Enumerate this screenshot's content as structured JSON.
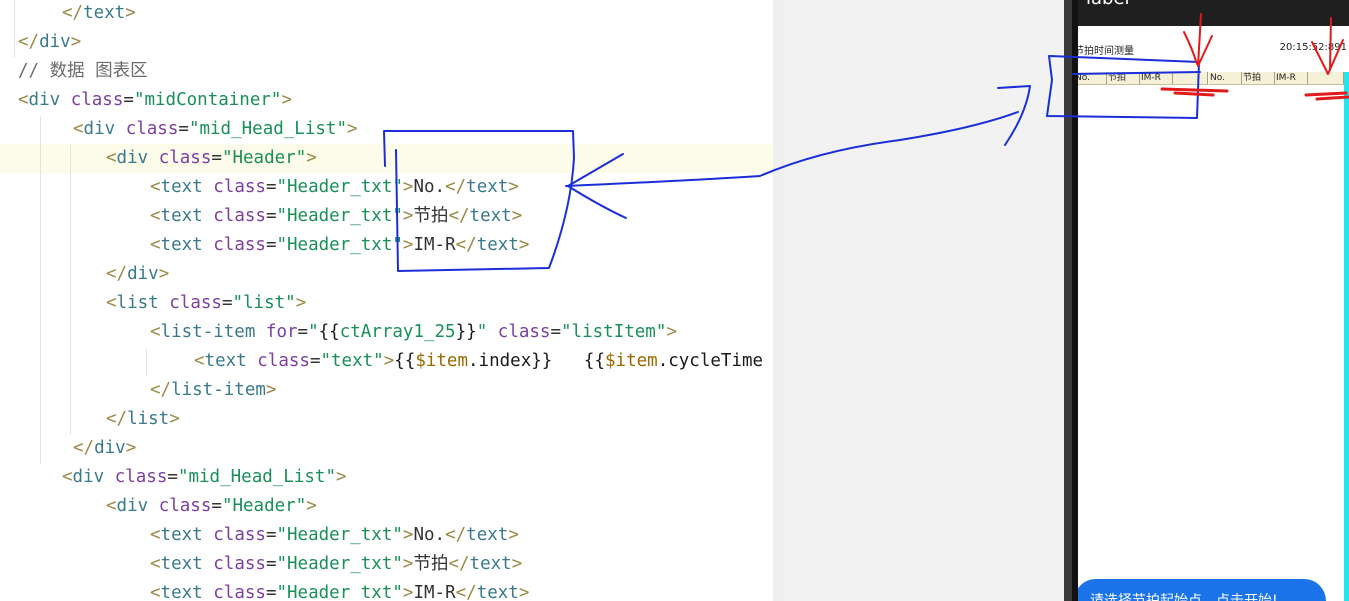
{
  "editor": {
    "lines": [
      {
        "indent": 62,
        "current": false,
        "tokens": [
          [
            "tb",
            "</"
          ],
          [
            "tag",
            "text"
          ],
          [
            "tb",
            ">"
          ]
        ]
      },
      {
        "indent": 18,
        "current": false,
        "tokens": [
          [
            "tb",
            "</"
          ],
          [
            "tag",
            "div"
          ],
          [
            "tb",
            ">"
          ]
        ]
      },
      {
        "indent": 18,
        "current": false,
        "tokens": [
          [
            "cmt",
            "// 数据 图表区"
          ]
        ]
      },
      {
        "indent": 18,
        "current": false,
        "tokens": [
          [
            "tb",
            "<"
          ],
          [
            "tag",
            "div"
          ],
          [
            "txt",
            " "
          ],
          [
            "attr",
            "class"
          ],
          [
            "eq",
            "="
          ],
          [
            "str",
            "\"midContainer\""
          ],
          [
            "tb",
            ">"
          ]
        ]
      },
      {
        "indent": 73,
        "current": false,
        "tokens": [
          [
            "tb",
            "<"
          ],
          [
            "tag",
            "div"
          ],
          [
            "txt",
            " "
          ],
          [
            "attr",
            "class"
          ],
          [
            "eq",
            "="
          ],
          [
            "str",
            "\"mid_Head_List\""
          ],
          [
            "tb",
            ">"
          ]
        ]
      },
      {
        "indent": 106,
        "current": true,
        "tokens": [
          [
            "tb",
            "<"
          ],
          [
            "tag",
            "div"
          ],
          [
            "txt",
            " "
          ],
          [
            "attr",
            "class"
          ],
          [
            "eq",
            "="
          ],
          [
            "str",
            "\"Header\""
          ],
          [
            "tb",
            ">"
          ]
        ]
      },
      {
        "indent": 150,
        "current": false,
        "tokens": [
          [
            "tb",
            "<"
          ],
          [
            "tag",
            "text"
          ],
          [
            "txt",
            " "
          ],
          [
            "attr",
            "class"
          ],
          [
            "eq",
            "="
          ],
          [
            "str",
            "\"Header_txt\""
          ],
          [
            "tb",
            ">"
          ],
          [
            "txt",
            "No."
          ],
          [
            "tb",
            "</"
          ],
          [
            "tag",
            "text"
          ],
          [
            "tb",
            ">"
          ]
        ]
      },
      {
        "indent": 150,
        "current": false,
        "tokens": [
          [
            "tb",
            "<"
          ],
          [
            "tag",
            "text"
          ],
          [
            "txt",
            " "
          ],
          [
            "attr",
            "class"
          ],
          [
            "eq",
            "="
          ],
          [
            "str",
            "\"Header_txt\""
          ],
          [
            "tb",
            ">"
          ],
          [
            "txt",
            "节拍"
          ],
          [
            "tb",
            "</"
          ],
          [
            "tag",
            "text"
          ],
          [
            "tb",
            ">"
          ]
        ]
      },
      {
        "indent": 150,
        "current": false,
        "tokens": [
          [
            "tb",
            "<"
          ],
          [
            "tag",
            "text"
          ],
          [
            "txt",
            " "
          ],
          [
            "attr",
            "class"
          ],
          [
            "eq",
            "="
          ],
          [
            "str",
            "\"Header_txt\""
          ],
          [
            "tb",
            ">"
          ],
          [
            "txt",
            "IM-R"
          ],
          [
            "tb",
            "</"
          ],
          [
            "tag",
            "text"
          ],
          [
            "tb",
            ">"
          ]
        ]
      },
      {
        "indent": 106,
        "current": false,
        "tokens": [
          [
            "tb",
            "</"
          ],
          [
            "tag",
            "div"
          ],
          [
            "tb",
            ">"
          ]
        ]
      },
      {
        "indent": 106,
        "current": false,
        "tokens": [
          [
            "tb",
            "<"
          ],
          [
            "tag",
            "list"
          ],
          [
            "txt",
            " "
          ],
          [
            "attr",
            "class"
          ],
          [
            "eq",
            "="
          ],
          [
            "str",
            "\"list\""
          ],
          [
            "tb",
            ">"
          ]
        ]
      },
      {
        "indent": 150,
        "current": false,
        "tokens": [
          [
            "tb",
            "<"
          ],
          [
            "tag",
            "list-item"
          ],
          [
            "txt",
            " "
          ],
          [
            "attr",
            "for"
          ],
          [
            "eq",
            "="
          ],
          [
            "str",
            "\""
          ],
          [
            "mus",
            "{{"
          ],
          [
            "str",
            "ctArray1_25"
          ],
          [
            "mus",
            "}}"
          ],
          [
            "str",
            "\""
          ],
          [
            "txt",
            " "
          ],
          [
            "attr",
            "class"
          ],
          [
            "eq",
            "="
          ],
          [
            "str",
            "\"listItem\""
          ],
          [
            "tb",
            ">"
          ]
        ]
      },
      {
        "indent": 194,
        "current": false,
        "tokens": [
          [
            "tb",
            "<"
          ],
          [
            "tag",
            "text"
          ],
          [
            "txt",
            " "
          ],
          [
            "attr",
            "class"
          ],
          [
            "eq",
            "="
          ],
          [
            "str",
            "\"text\""
          ],
          [
            "tb",
            ">"
          ],
          [
            "mus",
            "{{"
          ],
          [
            "vs",
            "$item"
          ],
          [
            "mus",
            ".index}}"
          ],
          [
            "txt",
            "   "
          ],
          [
            "mus",
            "{{"
          ],
          [
            "vs",
            "$item"
          ],
          [
            "mus",
            ".cycleTime"
          ]
        ]
      },
      {
        "indent": 150,
        "current": false,
        "tokens": [
          [
            "tb",
            "</"
          ],
          [
            "tag",
            "list-item"
          ],
          [
            "tb",
            ">"
          ]
        ]
      },
      {
        "indent": 106,
        "current": false,
        "tokens": [
          [
            "tb",
            "</"
          ],
          [
            "tag",
            "list"
          ],
          [
            "tb",
            ">"
          ]
        ]
      },
      {
        "indent": 73,
        "current": false,
        "tokens": [
          [
            "tb",
            "</"
          ],
          [
            "tag",
            "div"
          ],
          [
            "tb",
            ">"
          ]
        ]
      },
      {
        "indent": 62,
        "current": false,
        "tokens": [
          [
            "tb",
            "<"
          ],
          [
            "tag",
            "div"
          ],
          [
            "txt",
            " "
          ],
          [
            "attr",
            "class"
          ],
          [
            "eq",
            "="
          ],
          [
            "str",
            "\"mid_Head_List\""
          ],
          [
            "tb",
            ">"
          ]
        ]
      },
      {
        "indent": 106,
        "current": false,
        "tokens": [
          [
            "tb",
            "<"
          ],
          [
            "tag",
            "div"
          ],
          [
            "txt",
            " "
          ],
          [
            "attr",
            "class"
          ],
          [
            "eq",
            "="
          ],
          [
            "str",
            "\"Header\""
          ],
          [
            "tb",
            ">"
          ]
        ]
      },
      {
        "indent": 150,
        "current": false,
        "tokens": [
          [
            "tb",
            "<"
          ],
          [
            "tag",
            "text"
          ],
          [
            "txt",
            " "
          ],
          [
            "attr",
            "class"
          ],
          [
            "eq",
            "="
          ],
          [
            "str",
            "\"Header_txt\""
          ],
          [
            "tb",
            ">"
          ],
          [
            "txt",
            "No."
          ],
          [
            "tb",
            "</"
          ],
          [
            "tag",
            "text"
          ],
          [
            "tb",
            ">"
          ]
        ]
      },
      {
        "indent": 150,
        "current": false,
        "tokens": [
          [
            "tb",
            "<"
          ],
          [
            "tag",
            "text"
          ],
          [
            "txt",
            " "
          ],
          [
            "attr",
            "class"
          ],
          [
            "eq",
            "="
          ],
          [
            "str",
            "\"Header_txt\""
          ],
          [
            "tb",
            ">"
          ],
          [
            "txt",
            "节拍"
          ],
          [
            "tb",
            "</"
          ],
          [
            "tag",
            "text"
          ],
          [
            "tb",
            ">"
          ]
        ]
      },
      {
        "indent": 150,
        "current": false,
        "tokens": [
          [
            "tb",
            "<"
          ],
          [
            "tag",
            "text"
          ],
          [
            "txt",
            " "
          ],
          [
            "attr",
            "class"
          ],
          [
            "eq",
            "="
          ],
          [
            "str",
            "\"Header txt\""
          ],
          [
            "tb",
            ">"
          ],
          [
            "txt",
            "IM-R"
          ],
          [
            "tb",
            "</"
          ],
          [
            "tag",
            "text"
          ],
          [
            "tb",
            ">"
          ]
        ]
      }
    ]
  },
  "phone": {
    "window_title": "label",
    "app_title": "节拍时间测量",
    "time": "20:15:52:891",
    "lists": [
      {
        "headers": [
          "No.",
          "节拍",
          "IM-R",
          ""
        ]
      },
      {
        "headers": [
          "No.",
          "节拍",
          "IM-R",
          ""
        ]
      }
    ],
    "start_button_label": "请选择节拍起始点，点击开始!"
  },
  "colors": {
    "annotation_blue": "#1a2fd8",
    "annotation_red": "#e11a1a",
    "accent_cyan": "#22e5ee",
    "button_blue": "#1a73e8"
  }
}
